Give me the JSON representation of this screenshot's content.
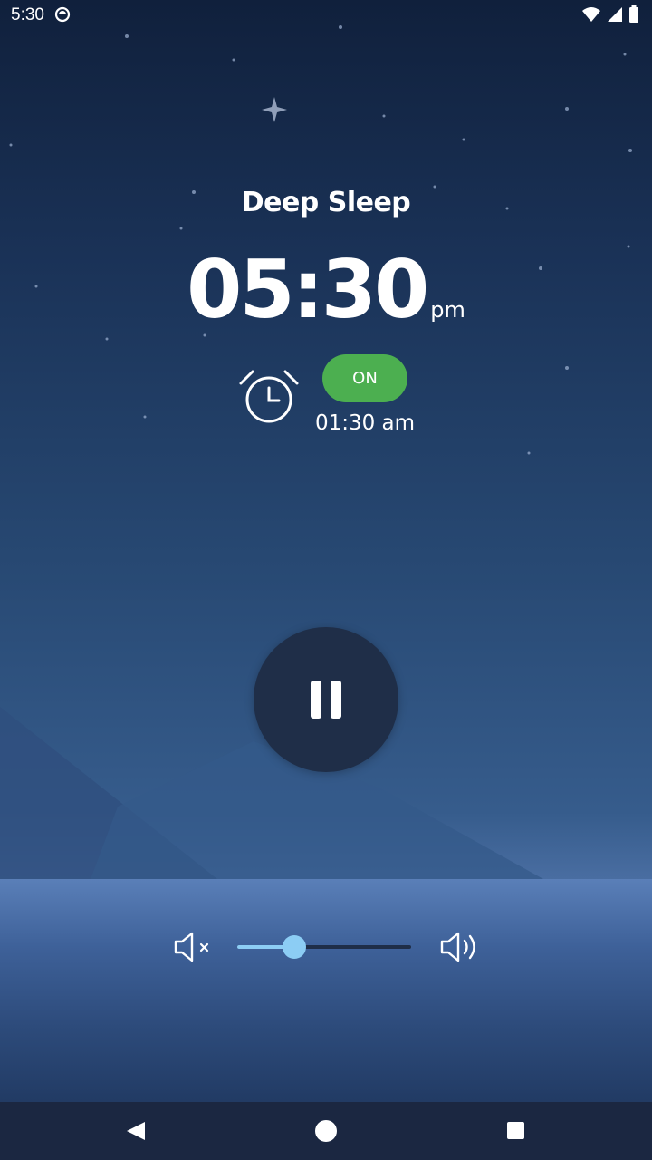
{
  "status_bar": {
    "time": "5:30"
  },
  "player": {
    "title": "Deep Sleep",
    "clock_time": "05:30",
    "clock_ampm": "pm",
    "alarm": {
      "toggle_label": "ON",
      "time": "01:30 am",
      "enabled": true
    },
    "state": "playing"
  },
  "volume": {
    "level": 0.33
  },
  "colors": {
    "accent_green": "#4caf50",
    "slider": "#8ccdf4",
    "button_dark": "#1f2e48"
  },
  "icons": [
    "notification-icon",
    "wifi-icon",
    "signal-icon",
    "battery-icon",
    "alarm-clock-icon",
    "pause-icon",
    "volume-mute-icon",
    "volume-up-icon",
    "back-icon",
    "home-icon",
    "recents-icon"
  ]
}
